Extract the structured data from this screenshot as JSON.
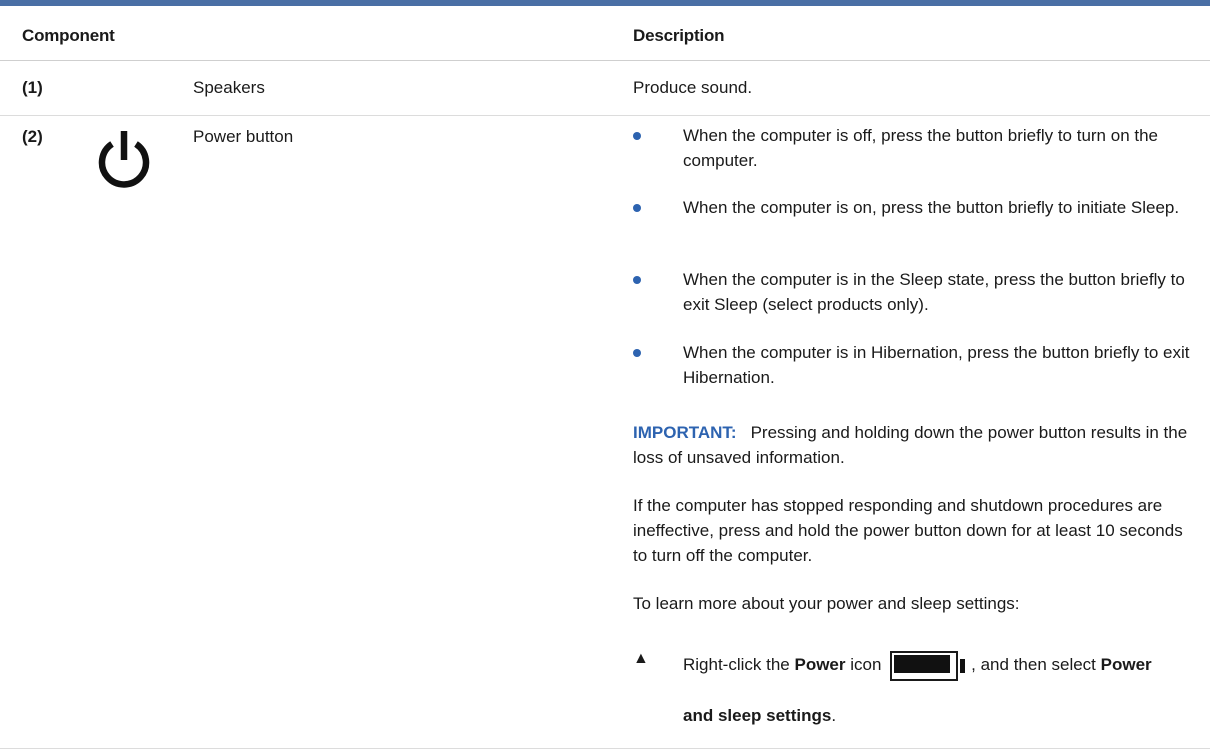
{
  "table": {
    "headers": {
      "component": "Component",
      "description": "Description"
    },
    "rows": [
      {
        "number": "(1)",
        "name": "Speakers",
        "description": "Produce sound."
      },
      {
        "number": "(2)",
        "icon": "power-icon",
        "name": "Power button",
        "bullets": [
          "When the computer is off, press the button briefly to turn on the computer.",
          "When the computer is on, press the button briefly to initiate Sleep.",
          "When the computer is in the Sleep state, press the button briefly to exit Sleep (select products only).",
          "When the computer is in Hibernation, press the button briefly to exit Hibernation."
        ],
        "important_label": "IMPORTANT:",
        "important_text": "Pressing and holding down the power button results in the loss of unsaved information.",
        "paragraph1": "If the computer has stopped responding and shutdown procedures are ineffective, press and hold the power button down for at least 10 seconds to turn off the computer.",
        "paragraph2": "To learn more about your power and sleep settings:",
        "step": {
          "marker": "▲",
          "prefix": "Right-click the ",
          "bold_power": "Power",
          "icon_word": " icon ",
          "battery_icon": "battery-icon",
          "middle": ", and then select ",
          "bold_power2": "Power",
          "line2_bold": "and sleep settings",
          "line2_end": "."
        }
      }
    ]
  },
  "colors": {
    "accent": "#2d63b0",
    "top_rule": "#4a6fa5"
  }
}
